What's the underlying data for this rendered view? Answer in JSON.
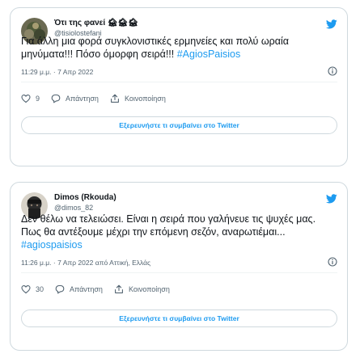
{
  "tweets": [
    {
      "display_name": "Ότι της φανεί 🏚🏚🏚",
      "handle": "@tisiolostefani",
      "text_before": "Για άλλη μια φορά συγκλονιστικές ερμηνείες και πολύ ωραία μηνύματα!!! Πόσο όμορφη σειρά!!! ",
      "hashtag": "#AgiosPaisios",
      "timestamp": "11:29 μ.μ. · 7 Απρ 2022",
      "likes": "9",
      "reply_label": "Απάντηση",
      "share_label": "Κοινοποίηση",
      "explore_label": "Εξερευνήστε τι συμβαίνει στο Twitter"
    },
    {
      "display_name": "Dimos (Rkouda)",
      "handle": "@dimos_82",
      "text_before": "Δεν θέλω να τελειώσει. Είναι η σειρά που γαλήνευε τις ψυχές μας. Πως θα αντέξουμε μέχρι την επόμενη σεζόν, αναρωτιέμαι... ",
      "hashtag": "#agiospaisios",
      "timestamp": "11:26 μ.μ. · 7 Απρ 2022 από Αττική, Ελλάς",
      "likes": "30",
      "reply_label": "Απάντηση",
      "share_label": "Κοινοποίηση",
      "explore_label": "Εξερευνήστε τι συμβαίνει στο Twitter"
    }
  ],
  "colors": {
    "accent": "#1d9bf0",
    "border": "#cfd9de",
    "secondary_text": "#536471"
  },
  "icons": [
    "avatar",
    "twitter-bird-icon",
    "info-icon",
    "heart-icon",
    "reply-icon",
    "share-icon"
  ]
}
